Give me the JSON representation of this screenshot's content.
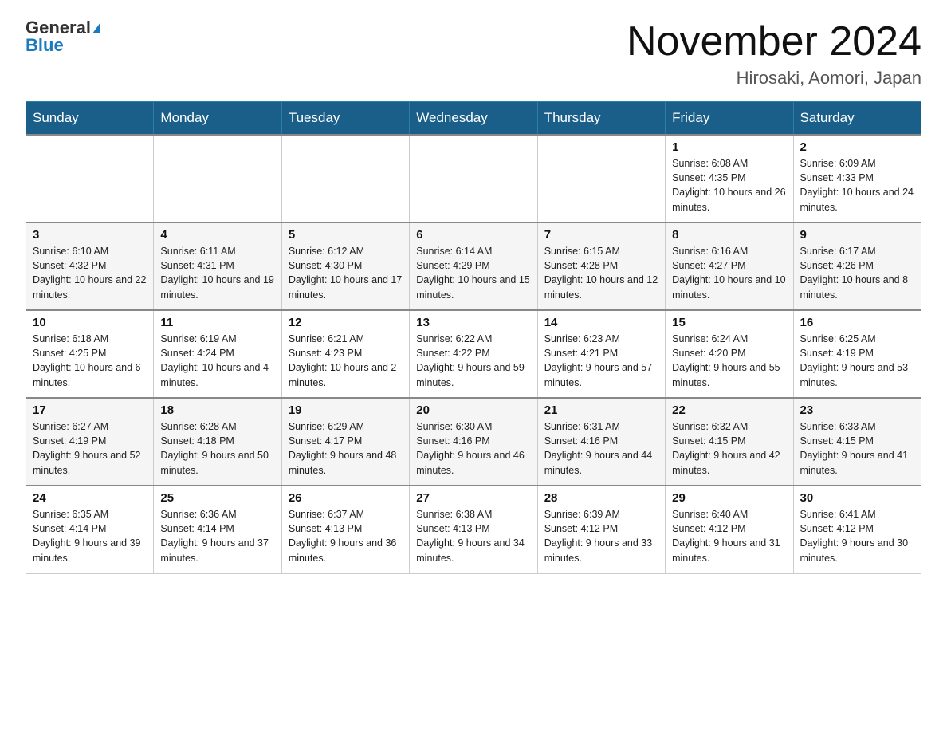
{
  "header": {
    "logo_general": "General",
    "logo_blue": "Blue",
    "month_year": "November 2024",
    "location": "Hirosaki, Aomori, Japan"
  },
  "days_of_week": [
    "Sunday",
    "Monday",
    "Tuesday",
    "Wednesday",
    "Thursday",
    "Friday",
    "Saturday"
  ],
  "weeks": [
    [
      {
        "day": "",
        "info": ""
      },
      {
        "day": "",
        "info": ""
      },
      {
        "day": "",
        "info": ""
      },
      {
        "day": "",
        "info": ""
      },
      {
        "day": "",
        "info": ""
      },
      {
        "day": "1",
        "info": "Sunrise: 6:08 AM\nSunset: 4:35 PM\nDaylight: 10 hours and 26 minutes."
      },
      {
        "day": "2",
        "info": "Sunrise: 6:09 AM\nSunset: 4:33 PM\nDaylight: 10 hours and 24 minutes."
      }
    ],
    [
      {
        "day": "3",
        "info": "Sunrise: 6:10 AM\nSunset: 4:32 PM\nDaylight: 10 hours and 22 minutes."
      },
      {
        "day": "4",
        "info": "Sunrise: 6:11 AM\nSunset: 4:31 PM\nDaylight: 10 hours and 19 minutes."
      },
      {
        "day": "5",
        "info": "Sunrise: 6:12 AM\nSunset: 4:30 PM\nDaylight: 10 hours and 17 minutes."
      },
      {
        "day": "6",
        "info": "Sunrise: 6:14 AM\nSunset: 4:29 PM\nDaylight: 10 hours and 15 minutes."
      },
      {
        "day": "7",
        "info": "Sunrise: 6:15 AM\nSunset: 4:28 PM\nDaylight: 10 hours and 12 minutes."
      },
      {
        "day": "8",
        "info": "Sunrise: 6:16 AM\nSunset: 4:27 PM\nDaylight: 10 hours and 10 minutes."
      },
      {
        "day": "9",
        "info": "Sunrise: 6:17 AM\nSunset: 4:26 PM\nDaylight: 10 hours and 8 minutes."
      }
    ],
    [
      {
        "day": "10",
        "info": "Sunrise: 6:18 AM\nSunset: 4:25 PM\nDaylight: 10 hours and 6 minutes."
      },
      {
        "day": "11",
        "info": "Sunrise: 6:19 AM\nSunset: 4:24 PM\nDaylight: 10 hours and 4 minutes."
      },
      {
        "day": "12",
        "info": "Sunrise: 6:21 AM\nSunset: 4:23 PM\nDaylight: 10 hours and 2 minutes."
      },
      {
        "day": "13",
        "info": "Sunrise: 6:22 AM\nSunset: 4:22 PM\nDaylight: 9 hours and 59 minutes."
      },
      {
        "day": "14",
        "info": "Sunrise: 6:23 AM\nSunset: 4:21 PM\nDaylight: 9 hours and 57 minutes."
      },
      {
        "day": "15",
        "info": "Sunrise: 6:24 AM\nSunset: 4:20 PM\nDaylight: 9 hours and 55 minutes."
      },
      {
        "day": "16",
        "info": "Sunrise: 6:25 AM\nSunset: 4:19 PM\nDaylight: 9 hours and 53 minutes."
      }
    ],
    [
      {
        "day": "17",
        "info": "Sunrise: 6:27 AM\nSunset: 4:19 PM\nDaylight: 9 hours and 52 minutes."
      },
      {
        "day": "18",
        "info": "Sunrise: 6:28 AM\nSunset: 4:18 PM\nDaylight: 9 hours and 50 minutes."
      },
      {
        "day": "19",
        "info": "Sunrise: 6:29 AM\nSunset: 4:17 PM\nDaylight: 9 hours and 48 minutes."
      },
      {
        "day": "20",
        "info": "Sunrise: 6:30 AM\nSunset: 4:16 PM\nDaylight: 9 hours and 46 minutes."
      },
      {
        "day": "21",
        "info": "Sunrise: 6:31 AM\nSunset: 4:16 PM\nDaylight: 9 hours and 44 minutes."
      },
      {
        "day": "22",
        "info": "Sunrise: 6:32 AM\nSunset: 4:15 PM\nDaylight: 9 hours and 42 minutes."
      },
      {
        "day": "23",
        "info": "Sunrise: 6:33 AM\nSunset: 4:15 PM\nDaylight: 9 hours and 41 minutes."
      }
    ],
    [
      {
        "day": "24",
        "info": "Sunrise: 6:35 AM\nSunset: 4:14 PM\nDaylight: 9 hours and 39 minutes."
      },
      {
        "day": "25",
        "info": "Sunrise: 6:36 AM\nSunset: 4:14 PM\nDaylight: 9 hours and 37 minutes."
      },
      {
        "day": "26",
        "info": "Sunrise: 6:37 AM\nSunset: 4:13 PM\nDaylight: 9 hours and 36 minutes."
      },
      {
        "day": "27",
        "info": "Sunrise: 6:38 AM\nSunset: 4:13 PM\nDaylight: 9 hours and 34 minutes."
      },
      {
        "day": "28",
        "info": "Sunrise: 6:39 AM\nSunset: 4:12 PM\nDaylight: 9 hours and 33 minutes."
      },
      {
        "day": "29",
        "info": "Sunrise: 6:40 AM\nSunset: 4:12 PM\nDaylight: 9 hours and 31 minutes."
      },
      {
        "day": "30",
        "info": "Sunrise: 6:41 AM\nSunset: 4:12 PM\nDaylight: 9 hours and 30 minutes."
      }
    ]
  ]
}
